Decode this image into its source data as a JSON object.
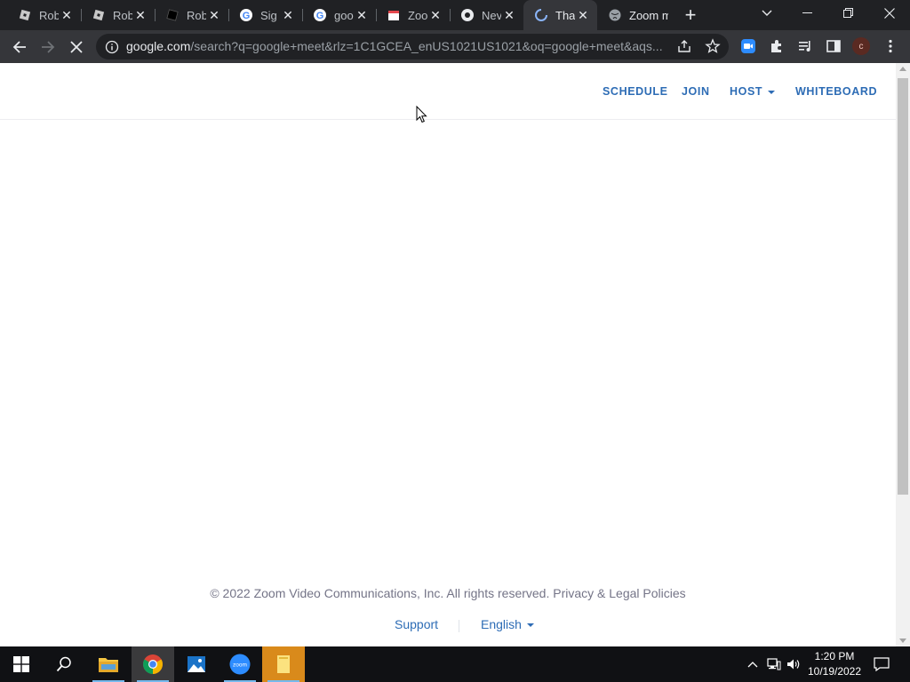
{
  "browser": {
    "tabs": [
      {
        "title": "Rob",
        "icon": "roblox-icon"
      },
      {
        "title": "Rob",
        "icon": "roblox-icon"
      },
      {
        "title": "Rob",
        "icon": "roblox-dark-icon"
      },
      {
        "title": "Sig",
        "icon": "google-icon"
      },
      {
        "title": "goo",
        "icon": "google-icon"
      },
      {
        "title": "Zoo",
        "icon": "zoom-store-icon"
      },
      {
        "title": "Nev",
        "icon": "chrome-icon"
      },
      {
        "title": "Tha",
        "icon": "loading-icon",
        "active": true
      },
      {
        "title": "Zoom m",
        "icon": "globe-icon"
      }
    ],
    "address": {
      "host": "google.com",
      "path": "/search?q=google+meet&rlz=1C1GCEA_enUS1021US1021&oq=google+meet&aqs..."
    }
  },
  "page": {
    "nav": {
      "schedule": "SCHEDULE",
      "join": "JOIN",
      "host": "HOST",
      "whiteboard": "WHITEBOARD"
    },
    "footer": {
      "copyright": "© 2022 Zoom Video Communications, Inc. All rights reserved.",
      "privacy": "Privacy & Legal Policies",
      "support": "Support",
      "language": "English"
    }
  },
  "taskbar": {
    "time": "1:20 PM",
    "date": "10/19/2022"
  },
  "colors": {
    "link_blue": "#2d6cb5",
    "footer_gray": "#747487",
    "chrome_dark": "#202124",
    "chrome_toolbar": "#35363a"
  }
}
